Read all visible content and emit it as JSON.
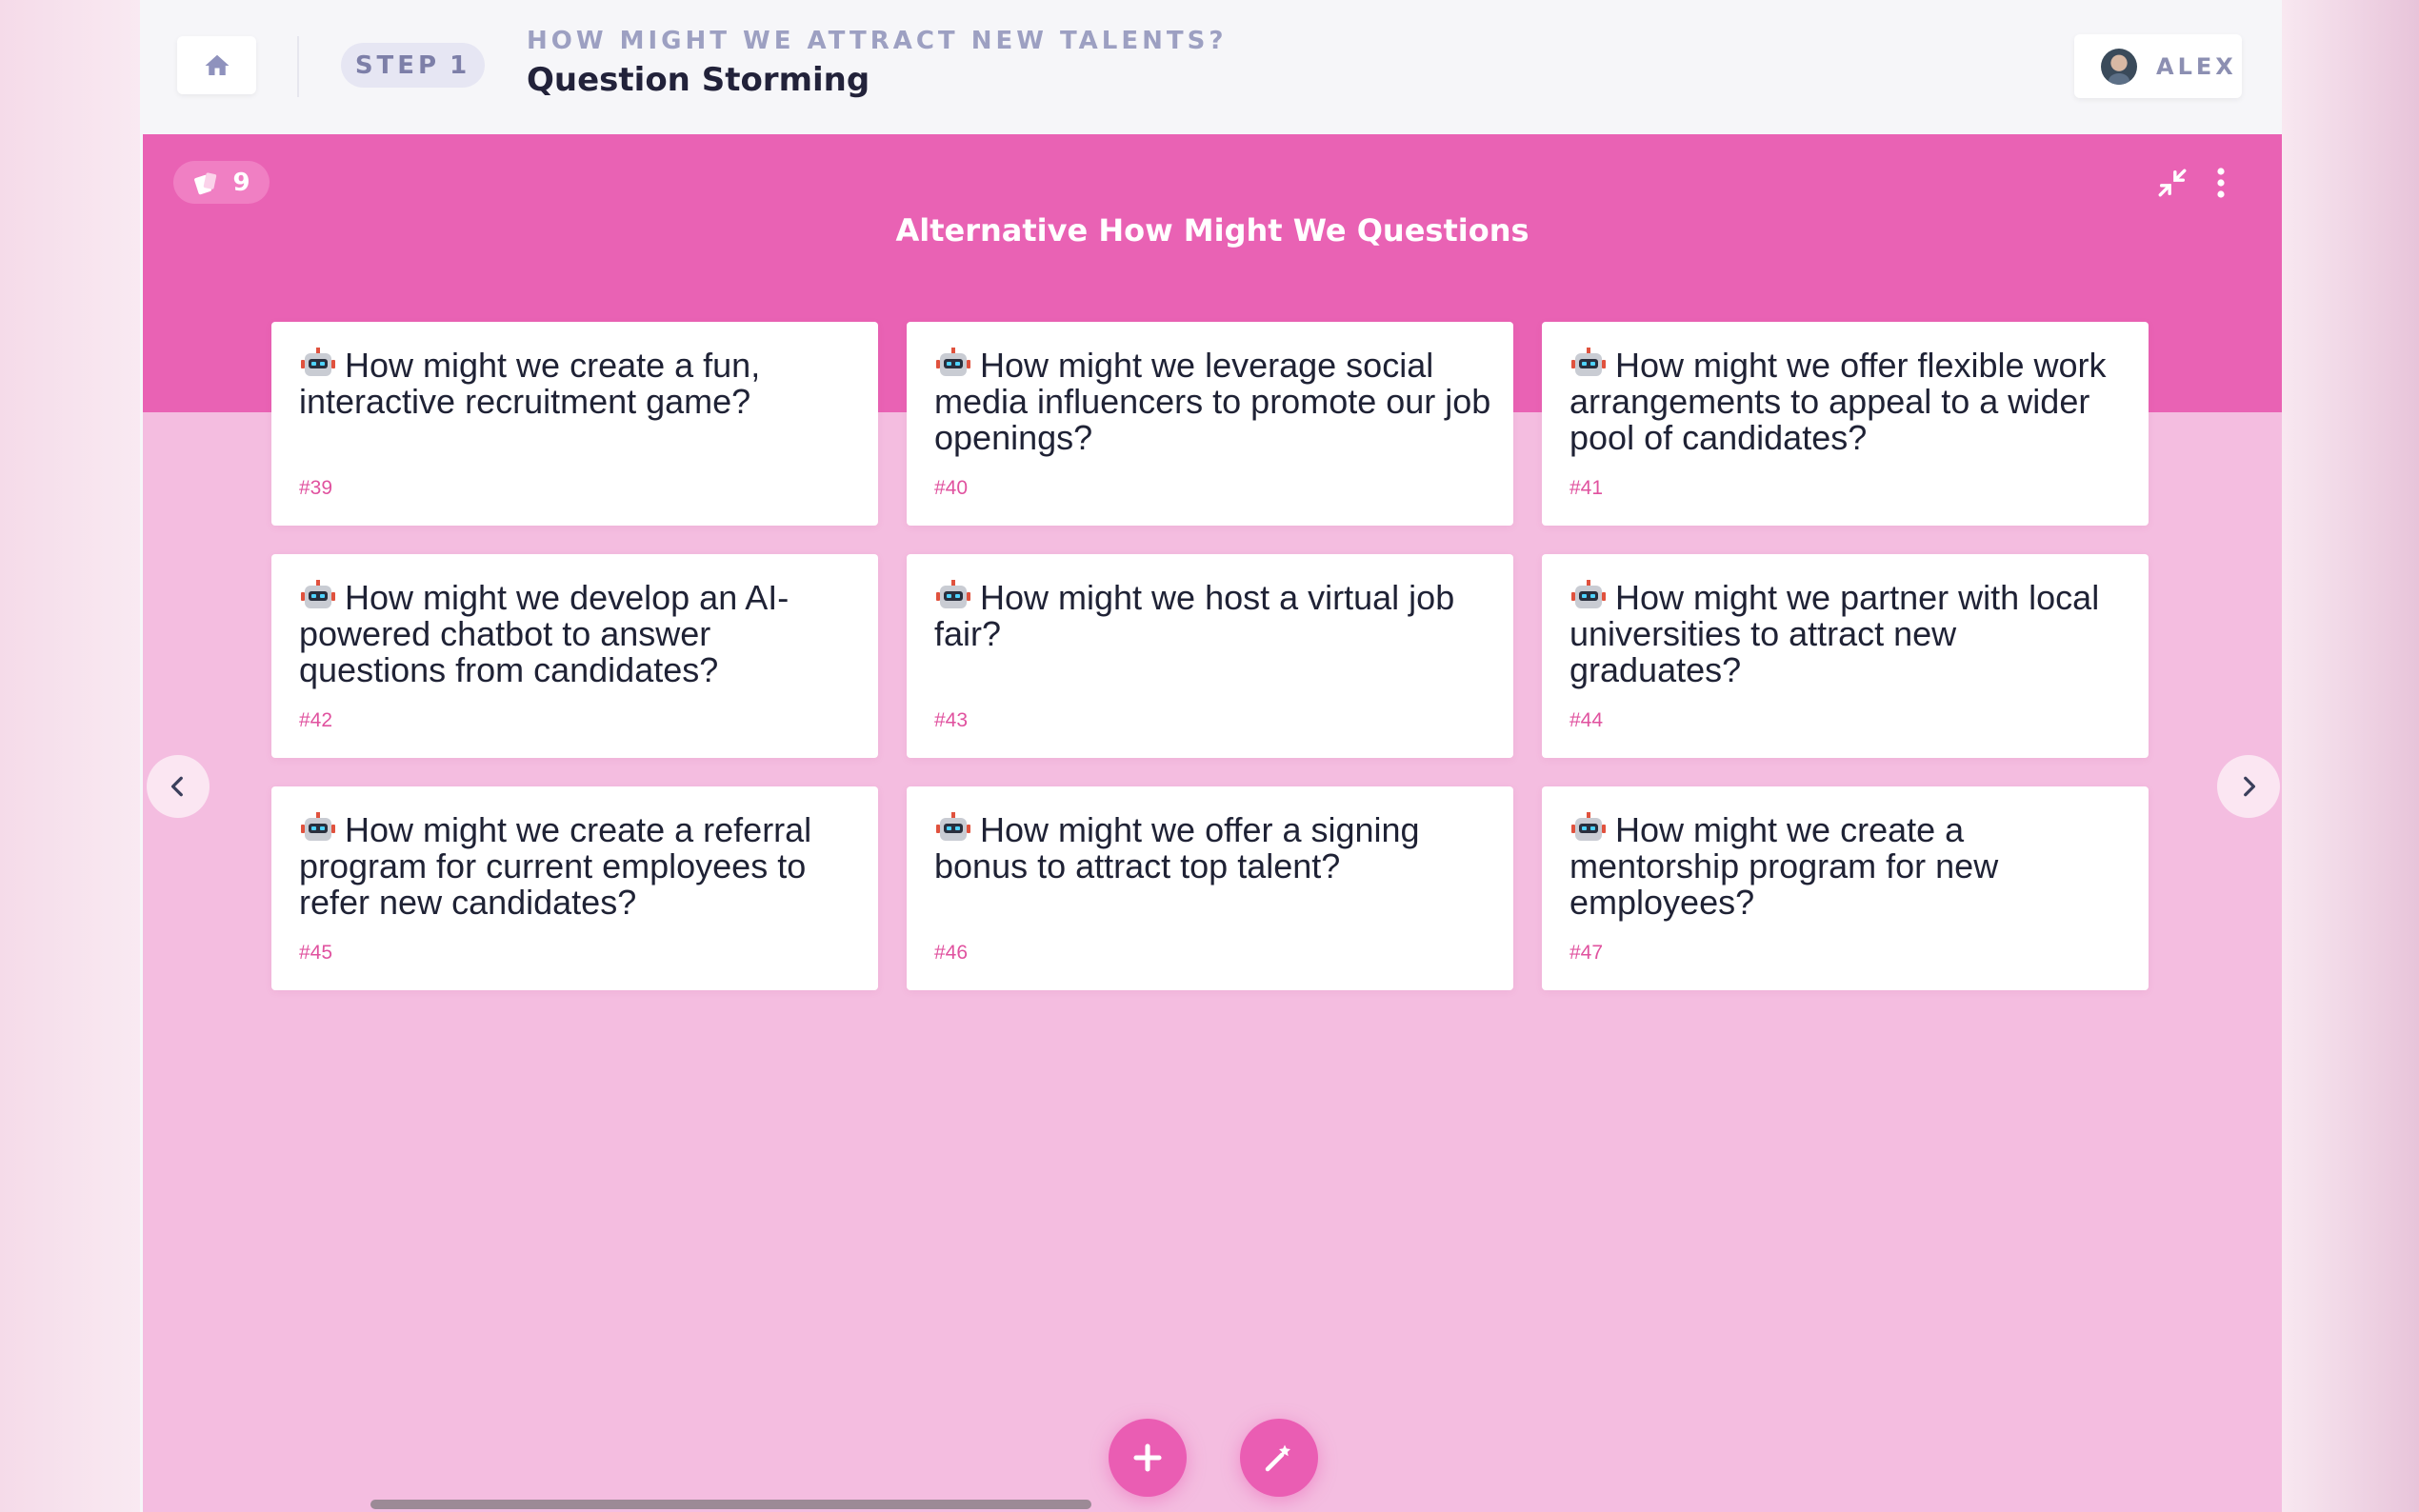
{
  "header": {
    "step_label": "STEP",
    "step_number": "1",
    "subtitle": "HOW MIGHT WE ATTRACT NEW TALENTS?",
    "title": "Question Storming",
    "user_name": "ALEX"
  },
  "board": {
    "count": "9",
    "title": "Alternative How Might We Questions"
  },
  "cards": [
    {
      "text": "How might we create a fun, interactive recruitment game?",
      "num": "#39"
    },
    {
      "text": "How might we leverage social media influencers to promote our job openings?",
      "num": "#40"
    },
    {
      "text": "How might we offer flexible work arrangements to appeal to a wider pool of candidates?",
      "num": "#41"
    },
    {
      "text": "How might we develop an AI-powered chatbot to answer questions from candidates?",
      "num": "#42"
    },
    {
      "text": "How might we host a virtual job fair?",
      "num": "#43"
    },
    {
      "text": "How might we partner with local universities to attract new graduates?",
      "num": "#44"
    },
    {
      "text": "How might we create a referral program for current employees to refer new candidates?",
      "num": "#45"
    },
    {
      "text": "How might we offer a signing bonus to attract top talent?",
      "num": "#46"
    },
    {
      "text": "How might we create a mentorship program for new employees?",
      "num": "#47"
    }
  ],
  "icons": {
    "home": "home-icon",
    "collapse": "collapse-icon",
    "more": "more-vertical-icon",
    "cards": "cards-icon",
    "robot": "robot-icon",
    "prev": "chevron-left-icon",
    "next": "chevron-right-icon",
    "add": "plus-icon",
    "magic": "magic-wand-icon"
  },
  "colors": {
    "accent": "#e962b4",
    "board_bg": "#f4bde0",
    "card_number": "#e0529f",
    "header_bg": "#f6f6f9"
  }
}
